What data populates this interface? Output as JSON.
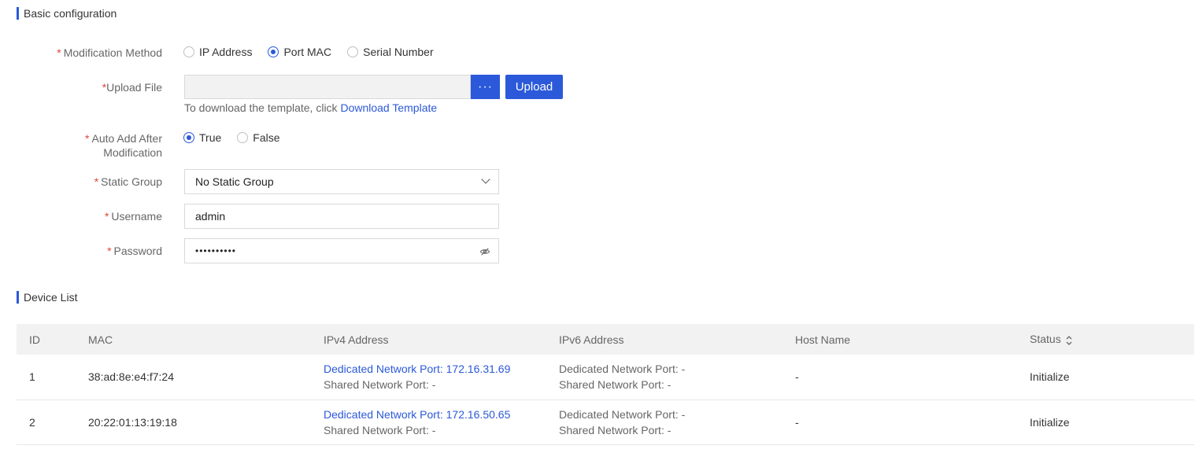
{
  "basic": {
    "section_title": "Basic configuration",
    "modification_method": {
      "label": "Modification Method",
      "options": [
        "IP Address",
        "Port MAC",
        "Serial Number"
      ],
      "selected": "Port MAC"
    },
    "upload_file": {
      "label": "Upload File",
      "browse_label": "···",
      "upload_label": "Upload",
      "hint_text": "To download the template, click ",
      "hint_link": "Download Template"
    },
    "auto_add": {
      "label_line1": "Auto Add After",
      "label_line2": "Modification",
      "options": [
        "True",
        "False"
      ],
      "selected": "True"
    },
    "static_group": {
      "label": "Static Group",
      "value": "No Static Group"
    },
    "username": {
      "label": "Username",
      "value": "admin"
    },
    "password": {
      "label": "Password",
      "value": "••••••••••"
    },
    "required_mark": "*"
  },
  "device_list": {
    "section_title": "Device List",
    "columns": [
      "ID",
      "MAC",
      "IPv4 Address",
      "IPv6 Address",
      "Host Name",
      "Status"
    ],
    "rows": [
      {
        "id": "1",
        "mac": "38:ad:8e:e4:f7:24",
        "ipv4_dedicated": "Dedicated Network Port: 172.16.31.69",
        "ipv4_shared": "Shared Network Port: -",
        "ipv6_dedicated": "Dedicated Network Port: -",
        "ipv6_shared": "Shared Network Port: -",
        "host_name": "-",
        "status": "Initialize"
      },
      {
        "id": "2",
        "mac": "20:22:01:13:19:18",
        "ipv4_dedicated": "Dedicated Network Port: 172.16.50.65",
        "ipv4_shared": "Shared Network Port: -",
        "ipv6_dedicated": "Dedicated Network Port: -",
        "ipv6_shared": "Shared Network Port: -",
        "host_name": "-",
        "status": "Initialize"
      }
    ]
  },
  "colors": {
    "accent": "#2b59d9",
    "required": "#e0453a",
    "header_bg": "#f2f2f2"
  },
  "icons": {
    "browse": "ellipsis-icon",
    "dropdown": "chevron-down-icon",
    "password_toggle": "eye-off-icon",
    "sort": "sort-icon"
  }
}
